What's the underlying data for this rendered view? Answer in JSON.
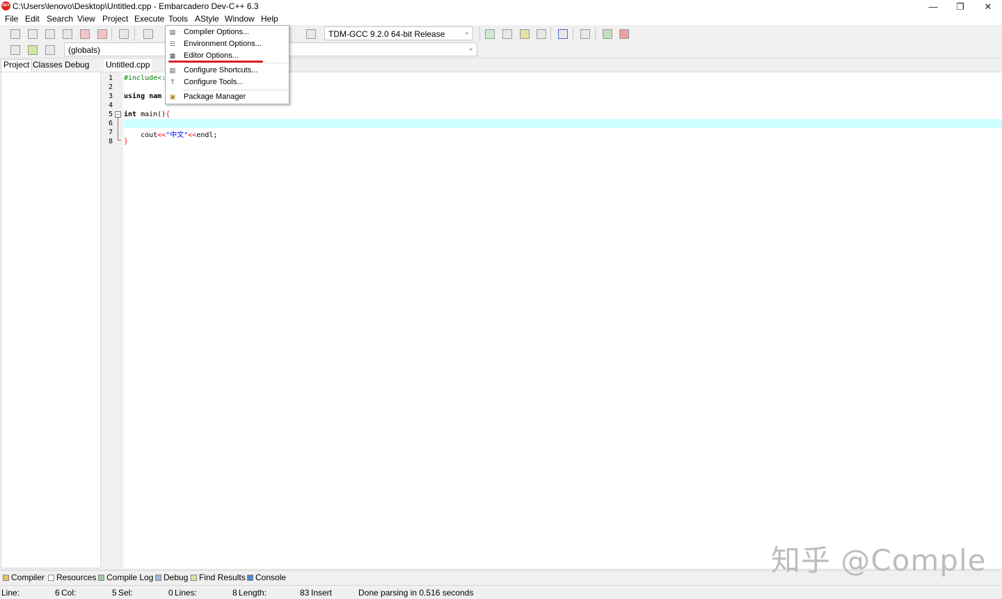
{
  "window": {
    "title": "C:\\Users\\lenovo\\Desktop\\Untitled.cpp - Embarcadero Dev-C++ 6.3",
    "icon_text": "DEV",
    "controls": {
      "minimize": "—",
      "restore": "❐",
      "close": "✕"
    }
  },
  "menubar": [
    "File",
    "Edit",
    "Search",
    "View",
    "Project",
    "Execute",
    "Tools",
    "AStyle",
    "Window",
    "Help"
  ],
  "toolbar": {
    "compiler": "TDM-GCC 9.2.0 64-bit Release",
    "scope": "(globals)"
  },
  "tools_menu": {
    "items": [
      {
        "label": "Compiler Options...",
        "icon": "compiler-options-icon"
      },
      {
        "label": "Environment Options...",
        "icon": "environment-options-icon"
      },
      {
        "label": "Editor Options...",
        "icon": "editor-options-icon",
        "highlighted": true
      },
      {
        "label": "Configure Shortcuts...",
        "icon": "shortcuts-icon"
      },
      {
        "label": "Configure Tools...",
        "icon": "tools-icon"
      },
      {
        "label": "Package Manager",
        "icon": "package-icon"
      }
    ],
    "highlight_color": "#e02020"
  },
  "left_panel": {
    "tabs": [
      "Project",
      "Classes",
      "Debug"
    ],
    "active_tab": "Project"
  },
  "editor": {
    "file_tab": "Untitled.cpp",
    "line_numbers": [
      "1",
      "2",
      "3",
      "4",
      "5",
      "6",
      "7",
      "8"
    ],
    "current_line_color": "#ccffff",
    "code": {
      "line1": "#include<:",
      "line3": "using nam",
      "line5_kw": "int",
      "line5_rest": " main()",
      "line5_brace": "{",
      "line7_a": "    cout",
      "line7_op1": "<<",
      "line7_str": "\"中文\"",
      "line7_op2": "<<",
      "line7_b": "endl;",
      "line8_brace": "}"
    }
  },
  "bottom_tabs": [
    "Compiler",
    "Resources",
    "Compile Log",
    "Debug",
    "Find Results",
    "Console"
  ],
  "status": {
    "line_label": "Line:",
    "line_value": "6",
    "col_label": "Col:",
    "col_value": "5",
    "sel_label": "Sel:",
    "sel_value": "0",
    "lines_label": "Lines:",
    "lines_value": "8",
    "length_label": "Length:",
    "length_value": "83",
    "mode": "Insert",
    "message": "Done parsing in 0.516 seconds"
  },
  "watermark": "知乎 @Comple"
}
